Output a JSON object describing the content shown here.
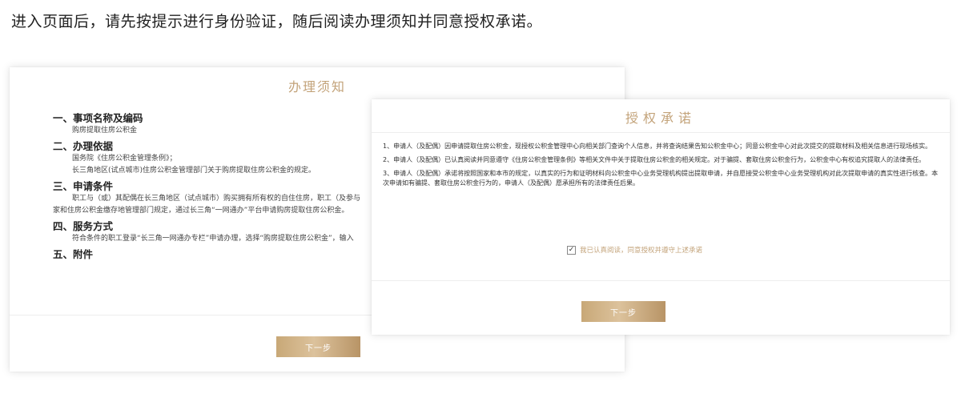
{
  "instruction": "进入页面后，请先按提示进行身份验证，随后阅读办理须知并同意授权承诺。",
  "notice_card": {
    "title": "办理须知",
    "sections": [
      {
        "heading": "一、事项名称及编码",
        "lines": [
          "购房提取住房公积金"
        ]
      },
      {
        "heading": "二、办理依据",
        "lines": [
          "国务院《住房公积金管理条例》；",
          "长三角地区(试点城市)住房公积金管理部门关于购房提取住房公积金的规定。"
        ]
      },
      {
        "heading": "三、申请条件",
        "lines": [
          "职工与（或）其配偶在长三角地区（试点城市）购买拥有所有权的自住住房，职工（及参与",
          "家和住房公积金缴存地管理部门规定，通过长三角“一网通办”平台申请购房提取住房公积金。"
        ]
      },
      {
        "heading": "四、服务方式",
        "lines": [
          "符合条件的职工登录“长三角一网通办专栏”申请办理，选择“购房提取住房公积金”，输入"
        ]
      },
      {
        "heading": "五、附件",
        "lines": []
      }
    ],
    "next_label": "下一步"
  },
  "auth_card": {
    "title": "授权承诺",
    "terms": [
      "1、申请人（及配偶）因申请提取住房公积金，现授权公积金管理中心向相关部门查询个人信息，并将查询结果告知公积金中心；同意公积金中心对此次提交的提取材料及相关信息进行现场核实。",
      "2、申请人（及配偶）已认真阅读并同意遵守《住房公积金管理条例》等相关文件中关于提取住房公积金的相关规定。对于骗提、套取住房公积金行为，公积金中心有权追究提取人的法律责任。",
      "3、申请人（及配偶）承诺将按照国家和本市的规定，以真实的行为和证明材料向公积金中心业务受理机构提出提取申请，并自愿接受公积金中心业务受理机构对此次提取申请的真实性进行核查。本次申请如有骗提、套取住房公积金行为的，申请人（及配偶）愿承担所有的法律责任后果。"
    ],
    "agree_label": "我已认真阅读，同意授权并遵守上述承诺",
    "agree_checked": "✓",
    "next_label": "下一步"
  },
  "colors": {
    "gold": "#c3a37a",
    "button_gradient_start": "#c8a877",
    "button_gradient_end": "#b89466"
  }
}
